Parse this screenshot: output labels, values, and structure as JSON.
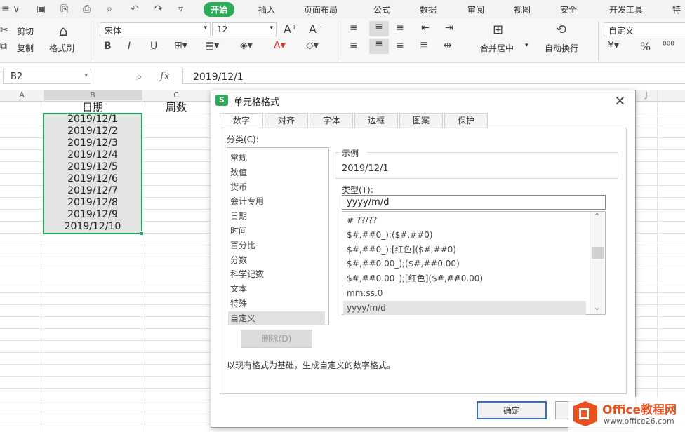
{
  "tabs": [
    "开始",
    "插入",
    "页面布局",
    "公式",
    "数据",
    "审阅",
    "视图",
    "安全",
    "开发工具",
    "特"
  ],
  "active_tab": "开始",
  "clipboard": {
    "cut": "剪切",
    "copy": "复制",
    "format_painter": "格式刷"
  },
  "font": {
    "name": "宋体",
    "size": "12"
  },
  "align": {
    "merge_center": "合并居中",
    "wrap_text": "自动换行"
  },
  "number_format": "自定义",
  "formula_bar": {
    "cell_ref": "B2",
    "fx": "fx",
    "value": "2019/12/1"
  },
  "columns": [
    "A",
    "B",
    "C",
    "J"
  ],
  "sheet": {
    "header_b": "日期",
    "header_c": "周数",
    "dates": [
      "2019/12/1",
      "2019/12/2",
      "2019/12/3",
      "2019/12/4",
      "2019/12/5",
      "2019/12/6",
      "2019/12/7",
      "2019/12/8",
      "2019/12/9",
      "2019/12/10"
    ]
  },
  "dialog": {
    "title": "单元格格式",
    "tabs": [
      "数字",
      "对齐",
      "字体",
      "边框",
      "图案",
      "保护"
    ],
    "active_tab": "数字",
    "category_label": "分类(C):",
    "categories": [
      "常规",
      "数值",
      "货币",
      "会计专用",
      "日期",
      "时间",
      "百分比",
      "分数",
      "科学记数",
      "文本",
      "特殊",
      "自定义"
    ],
    "selected_category": "自定义",
    "sample_label": "示例",
    "sample_value": "2019/12/1",
    "type_label": "类型(T):",
    "type_value": "yyyy/m/d",
    "type_list": [
      "# ??/??",
      "$#,##0_);($#,##0)",
      "$#,##0_);[红色]($#,##0)",
      "$#,##0.00_);($#,##0.00)",
      "$#,##0.00_);[红色]($#,##0.00)",
      "mm:ss.0",
      "yyyy/m/d"
    ],
    "selected_type": "yyyy/m/d",
    "delete_button": "删除(D)",
    "description": "以现有格式为基础，生成自定义的数字格式。",
    "ok_button": "确定"
  },
  "watermark": {
    "brand": "Office教程网",
    "url": "www.office26.com"
  },
  "colors": {
    "accent": "#2daa57",
    "selection": "#21a366",
    "office_logo": "#e8501e"
  }
}
